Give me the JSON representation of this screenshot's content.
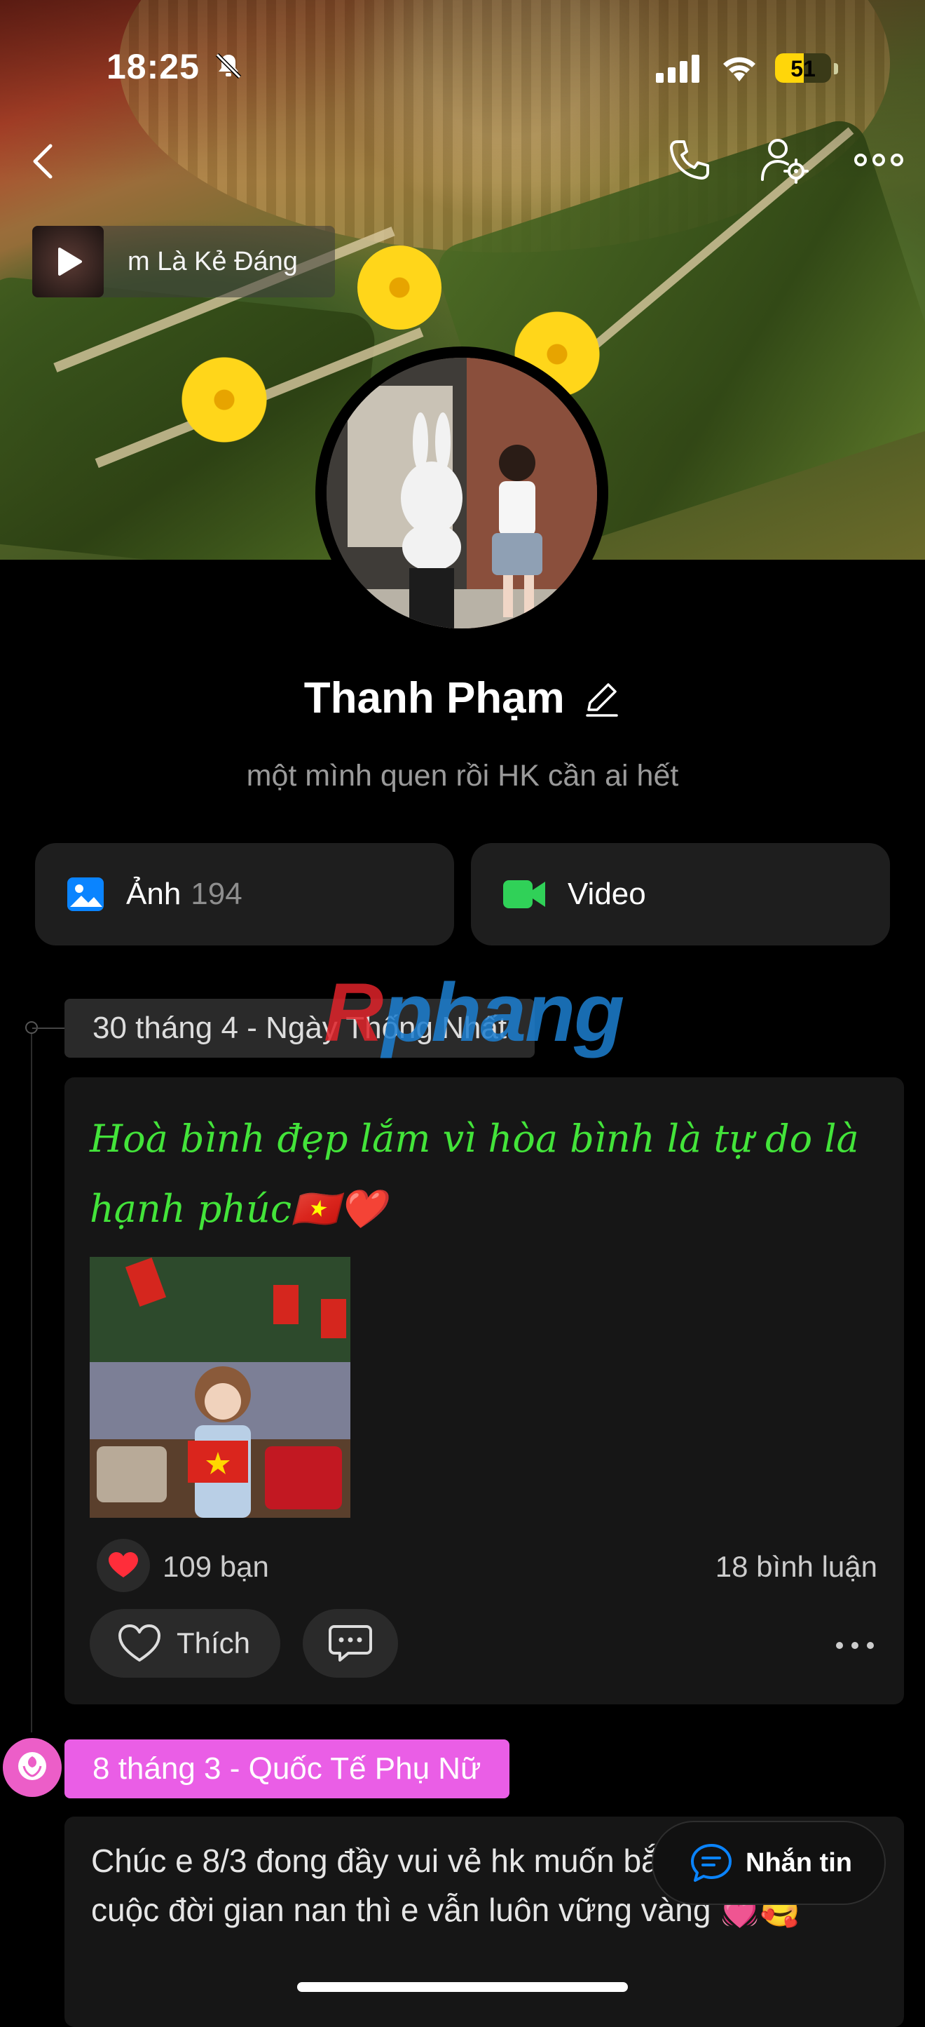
{
  "status_bar": {
    "time": "18:25",
    "battery": "51",
    "battery_level": 0.51
  },
  "music": {
    "title": "m Là Kẻ Đáng"
  },
  "profile": {
    "name": "Thanh Phạm",
    "bio": "một mình quen rồi HK cần ai hết"
  },
  "media_tiles": [
    {
      "label": "Ảnh",
      "count": "194",
      "icon": "photo-icon"
    },
    {
      "label": "Video",
      "count": "",
      "icon": "video-icon"
    }
  ],
  "watermark": {
    "part1": "R",
    "part2": "phang"
  },
  "posts": [
    {
      "tag": "30 tháng 4 - Ngày Thống Nhất",
      "text": "Hoà bình đẹp lắm vì hòa bình là tự do là hạnh phúc🇻🇳❤️",
      "reactions": "109 bạn",
      "comments": "18 bình luận",
      "like_label": "Thích"
    },
    {
      "tag": "8 tháng 3 - Quốc Tế Phụ Nữ",
      "text": "Chúc e 8/3 đong đầy vui vẻ hk muốn bắt an dẫu cuộc đời gian nan thì e vẫn luôn vững vàng 💓🥰"
    }
  ],
  "message_button": {
    "label": "Nhắn tin"
  },
  "colors": {
    "background": "#000000",
    "card": "#161616",
    "script_green": "#43e43a",
    "pink_tag": "#ea5ee6",
    "photo_blue": "#0a84ff",
    "video_green": "#30d158",
    "battery_yellow": "#ffd60a"
  }
}
